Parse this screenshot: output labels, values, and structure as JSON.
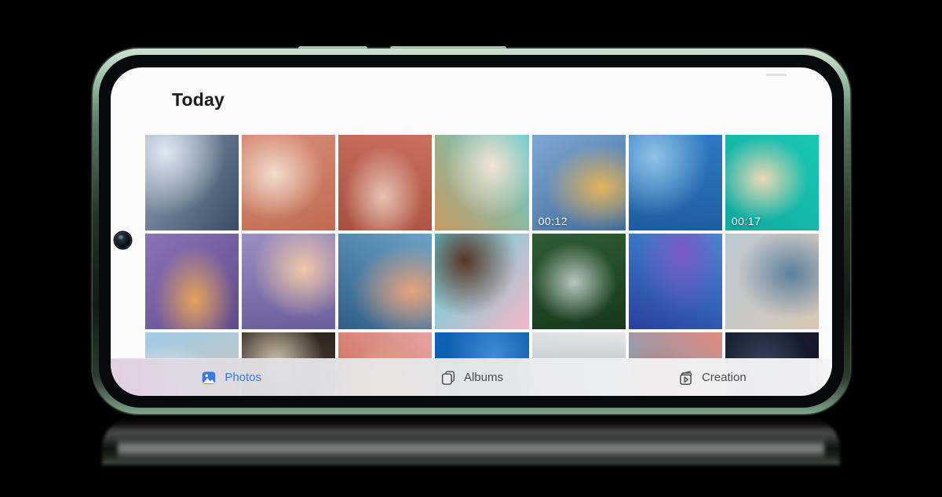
{
  "app": {
    "title": "Today"
  },
  "device": {
    "frame_color": "#7fa58a",
    "bezel_color": "#07090a",
    "screen_bg": "#fbfbfb",
    "buttons": [
      {
        "name": "volume-button"
      },
      {
        "name": "power-button"
      }
    ],
    "front_camera": "punch-hole-camera"
  },
  "gallery": {
    "header": "Today",
    "columns": 7,
    "tiles": [
      {
        "id": "t1",
        "name": "snow-mountain-photo",
        "badge": null,
        "colors": [
          "#8e9fb4",
          "#3c4d63",
          "#dfe7f0"
        ]
      },
      {
        "id": "t2",
        "name": "woman-terracotta-photo",
        "badge": null,
        "colors": [
          "#d98e77",
          "#bf6b52",
          "#f3ddcf"
        ]
      },
      {
        "id": "t3",
        "name": "woman-arch-portrait",
        "badge": null,
        "colors": [
          "#c9705f",
          "#a8503f",
          "#e8c3b4"
        ]
      },
      {
        "id": "t4",
        "name": "woman-sunhat-photo",
        "badge": null,
        "colors": [
          "#5fcfd0",
          "#c79a61",
          "#f2e4d6"
        ]
      },
      {
        "id": "t5",
        "name": "lake-tree-video",
        "badge": "00:12",
        "colors": [
          "#7ea9d4",
          "#3f6a99",
          "#e4b45c"
        ]
      },
      {
        "id": "t6",
        "name": "blue-boathouse-photo",
        "badge": null,
        "colors": [
          "#2f79c2",
          "#1d5d9f",
          "#8fc4e8"
        ]
      },
      {
        "id": "t7",
        "name": "turquoise-beach-video",
        "badge": "00:17",
        "colors": [
          "#19c7b4",
          "#0fa9a0",
          "#ecd9b4"
        ]
      },
      {
        "id": "t8",
        "name": "lavender-field-photo",
        "badge": null,
        "colors": [
          "#8b73b8",
          "#5e4a8c",
          "#e6a35c"
        ]
      },
      {
        "id": "t9",
        "name": "purple-mountains-photo",
        "badge": null,
        "colors": [
          "#9b8ec2",
          "#6a5f9c",
          "#f0c9a8"
        ]
      },
      {
        "id": "t10",
        "name": "pier-sunset-photo",
        "badge": null,
        "colors": [
          "#6aa3c9",
          "#2f5e87",
          "#e8a27a"
        ]
      },
      {
        "id": "t11",
        "name": "donuts-flatlay-photo",
        "badge": null,
        "colors": [
          "#57d4dd",
          "#f3b6c7",
          "#5a3526"
        ]
      },
      {
        "id": "t12",
        "name": "forest-road-photo",
        "badge": null,
        "colors": [
          "#2f5d35",
          "#17381d",
          "#b8c6bd"
        ]
      },
      {
        "id": "t13",
        "name": "blue-butterfly-photo",
        "badge": null,
        "colors": [
          "#3f8fd6",
          "#2a3f9e",
          "#7b5ac4"
        ]
      },
      {
        "id": "t14",
        "name": "family-beach-photo",
        "badge": null,
        "colors": [
          "#bcc9d4",
          "#d9c7b4",
          "#5b7f9c"
        ]
      },
      {
        "id": "t15",
        "name": "sailboat-sky-photo",
        "badge": null,
        "colors": [
          "#9fcbe8",
          "#d9c3a4",
          "#f2f5f8"
        ]
      },
      {
        "id": "t16",
        "name": "gallery-couple-photo",
        "badge": null,
        "colors": [
          "#2b2420",
          "#6b5544",
          "#cfc2ae"
        ]
      },
      {
        "id": "t17",
        "name": "straw-hat-pink-photo",
        "badge": null,
        "colors": [
          "#e8a3a3",
          "#c9694f",
          "#d8b173"
        ]
      },
      {
        "id": "t18",
        "name": "blue-gradient-photo",
        "badge": null,
        "colors": [
          "#0f63b8",
          "#0a4a91",
          "#3f8cd4"
        ]
      },
      {
        "id": "t19",
        "name": "laptop-hands-photo",
        "badge": null,
        "colors": [
          "#e8e8e6",
          "#8fa4b4",
          "#c4cdd4"
        ]
      },
      {
        "id": "t20",
        "name": "pink-building-hat-photo",
        "badge": null,
        "colors": [
          "#e2897c",
          "#5fa8cf",
          "#c96a55"
        ]
      },
      {
        "id": "t21",
        "name": "dark-blue-texture-photo",
        "badge": null,
        "colors": [
          "#1b2336",
          "#0c1120",
          "#3a4a63"
        ]
      }
    ]
  },
  "bottom_nav": {
    "active": "photos",
    "items": [
      {
        "id": "photos",
        "label": "Photos",
        "icon": "photos-icon",
        "active": true
      },
      {
        "id": "albums",
        "label": "Albums",
        "icon": "albums-icon",
        "active": false
      },
      {
        "id": "creation",
        "label": "Creation",
        "icon": "creation-icon",
        "active": false
      }
    ],
    "accent_color": "#3779e8",
    "inactive_color": "#4a4a4e"
  }
}
